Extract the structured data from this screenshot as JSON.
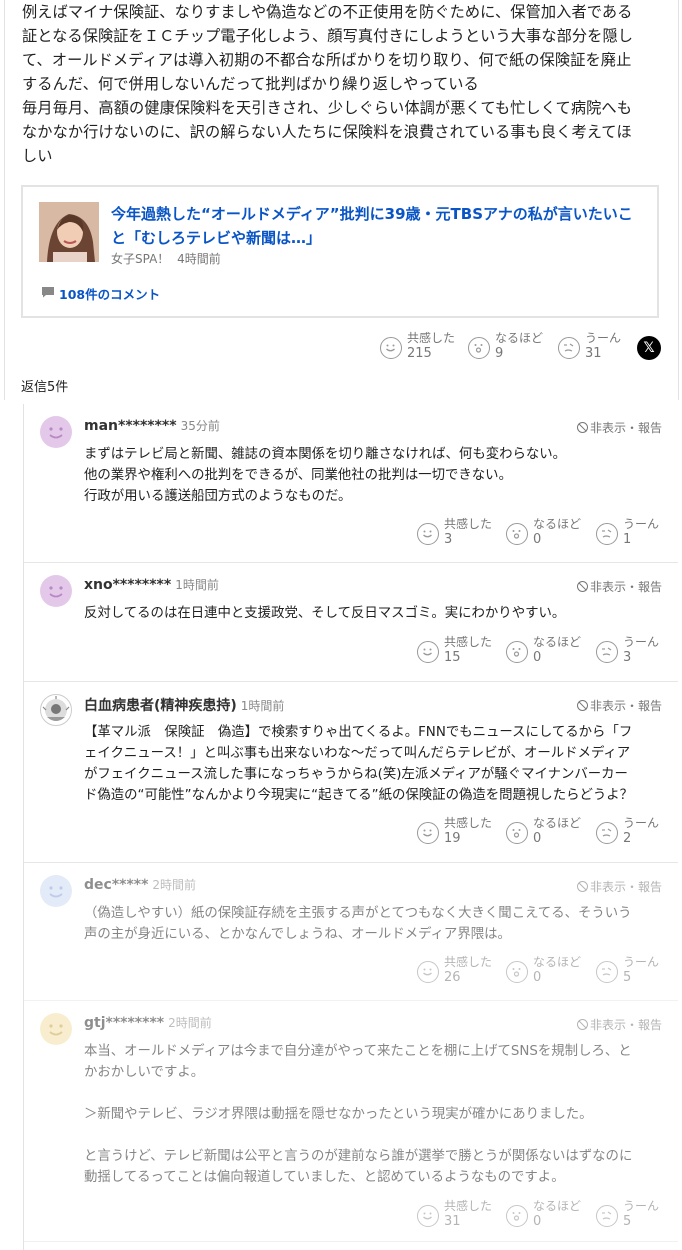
{
  "main_comment": {
    "lines": [
      "例えばマイナ保険証、なりすましや偽造などの不正使用を防ぐために、保管加入者である",
      "証となる保険証をＩＣチップ電子化しよう、顔写真付きにしようという大事な部分を隠し",
      "て、オールドメディアは導入初期の不都合な所ばかりを切り取り、何で紙の保険証を廃止",
      "するんだ、何で併用しないんだって批判ばかり繰り返しやっている",
      "毎月毎月、高額の健康保険料を天引きされ、少しぐらい体調が悪くても忙しくて病院へも",
      "なかなか行けないのに、訳の解らない人たちに保険料を浪費されている事も良く考えてほ",
      "しい"
    ],
    "reactions": {
      "empathy_label": "共感した",
      "empathy": "215",
      "naruhodo_label": "なるほど",
      "naruhodo": "9",
      "uun_label": "うーん",
      "uun": "31"
    },
    "x_label": "𝕏"
  },
  "link_card": {
    "title_lines": [
      "今年過熱した“オールドメディア”批判に39歳・元TBSアナの私が言いたいこ",
      "と「むしろテレビや新聞は…」"
    ],
    "source": "女子SPA！",
    "time": "4時間前",
    "comments": "108件のコメント"
  },
  "reply_count": "返信5件",
  "hide_report_label": "非表示・報告",
  "colors": {
    "link": "#0a55c6",
    "border": "#e3e3e3"
  },
  "replies": [
    {
      "user": "man********",
      "time": "35分前",
      "lines": [
        "まずはテレビ局と新聞、雑誌の資本関係を切り離さなければ、何も変わらない。",
        "他の業界や権利への批判をできるが、同業他社の批判は一切できない。",
        "行政が用いる護送船団方式のようなものだ。"
      ],
      "empathy": "3",
      "naruhodo": "0",
      "uun": "1"
    },
    {
      "user": "xno********",
      "time": "1時間前",
      "lines": [
        "反対してるのは在日連中と支援政党、そして反日マスゴミ。実にわかりやすい。"
      ],
      "empathy": "15",
      "naruhodo": "0",
      "uun": "3"
    },
    {
      "user": "白血病患者(精神疾患持)",
      "time": "1時間前",
      "lines": [
        "【革マル派　保険証　偽造】で検索すりゃ出てくるよ。FNNでもニュースにしてるから「フ",
        "ェイクニュース！」と叫ぶ事も出来ないわな〜だって叫んだらテレビが、オールドメディア",
        "がフェイクニュース流した事になっちゃうからね(笑)左派メディアが騒ぐマイナンバーカー",
        "ド偽造の“可能性”なんかより今現実に“起きてる”紙の保険証の偽造を問題視したらどうよ？"
      ],
      "empathy": "19",
      "naruhodo": "0",
      "uun": "2"
    },
    {
      "user": "dec*****",
      "time": "2時間前",
      "lines": [
        "（偽造しやすい）紙の保険証存続を主張する声がとてつもなく大きく聞こえてる、そういう",
        "声の主が身近にいる、とかなんでしょうね、オールドメディア界隈は。"
      ],
      "empathy": "26",
      "naruhodo": "0",
      "uun": "5"
    },
    {
      "user": "gtj********",
      "time": "2時間前",
      "lines": [
        "本当、オールドメディアは今まで自分達がやって来たことを棚に上げてSNSを規制しろ、と",
        "かおかしいですよ。",
        "",
        "＞新聞やテレビ、ラジオ界隈は動揺を隠せなかったという現実が確かにありました。",
        "",
        "と言うけど、テレビ新聞は公平と言うのが建前なら誰が選挙で勝とうが関係ないはずなのに",
        "動揺してるってことは偏向報道していました、と認めているようなものですよ。"
      ],
      "empathy": "31",
      "naruhodo": "0",
      "uun": "5"
    }
  ]
}
